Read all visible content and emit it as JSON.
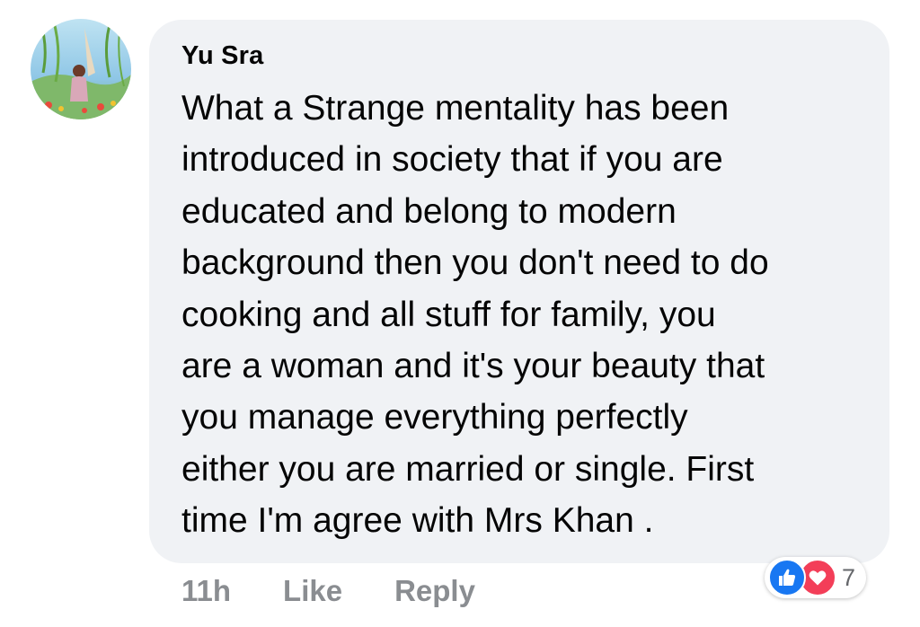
{
  "comment": {
    "author": "Yu Sra",
    "text": "What a Strange mentality has been\nintroduced in society that if you are\neducated and belong to modern\nbackground then you don't need to do\ncooking and all stuff  for family, you\nare a woman and it's your beauty that\nyou manage everything perfectly\neither you are married or single. First\ntime I'm agree with Mrs Khan .",
    "timestamp": "11h",
    "like_label": "Like",
    "reply_label": "Reply",
    "reactions": {
      "icons": [
        "thumbs-up-icon",
        "heart-icon"
      ],
      "count": "7"
    }
  },
  "colors": {
    "bubble": "#f0f2f5",
    "text": "#050505",
    "meta": "#8a8d91",
    "like_reaction": "#1877f2",
    "love_reaction": "#f33e58"
  }
}
